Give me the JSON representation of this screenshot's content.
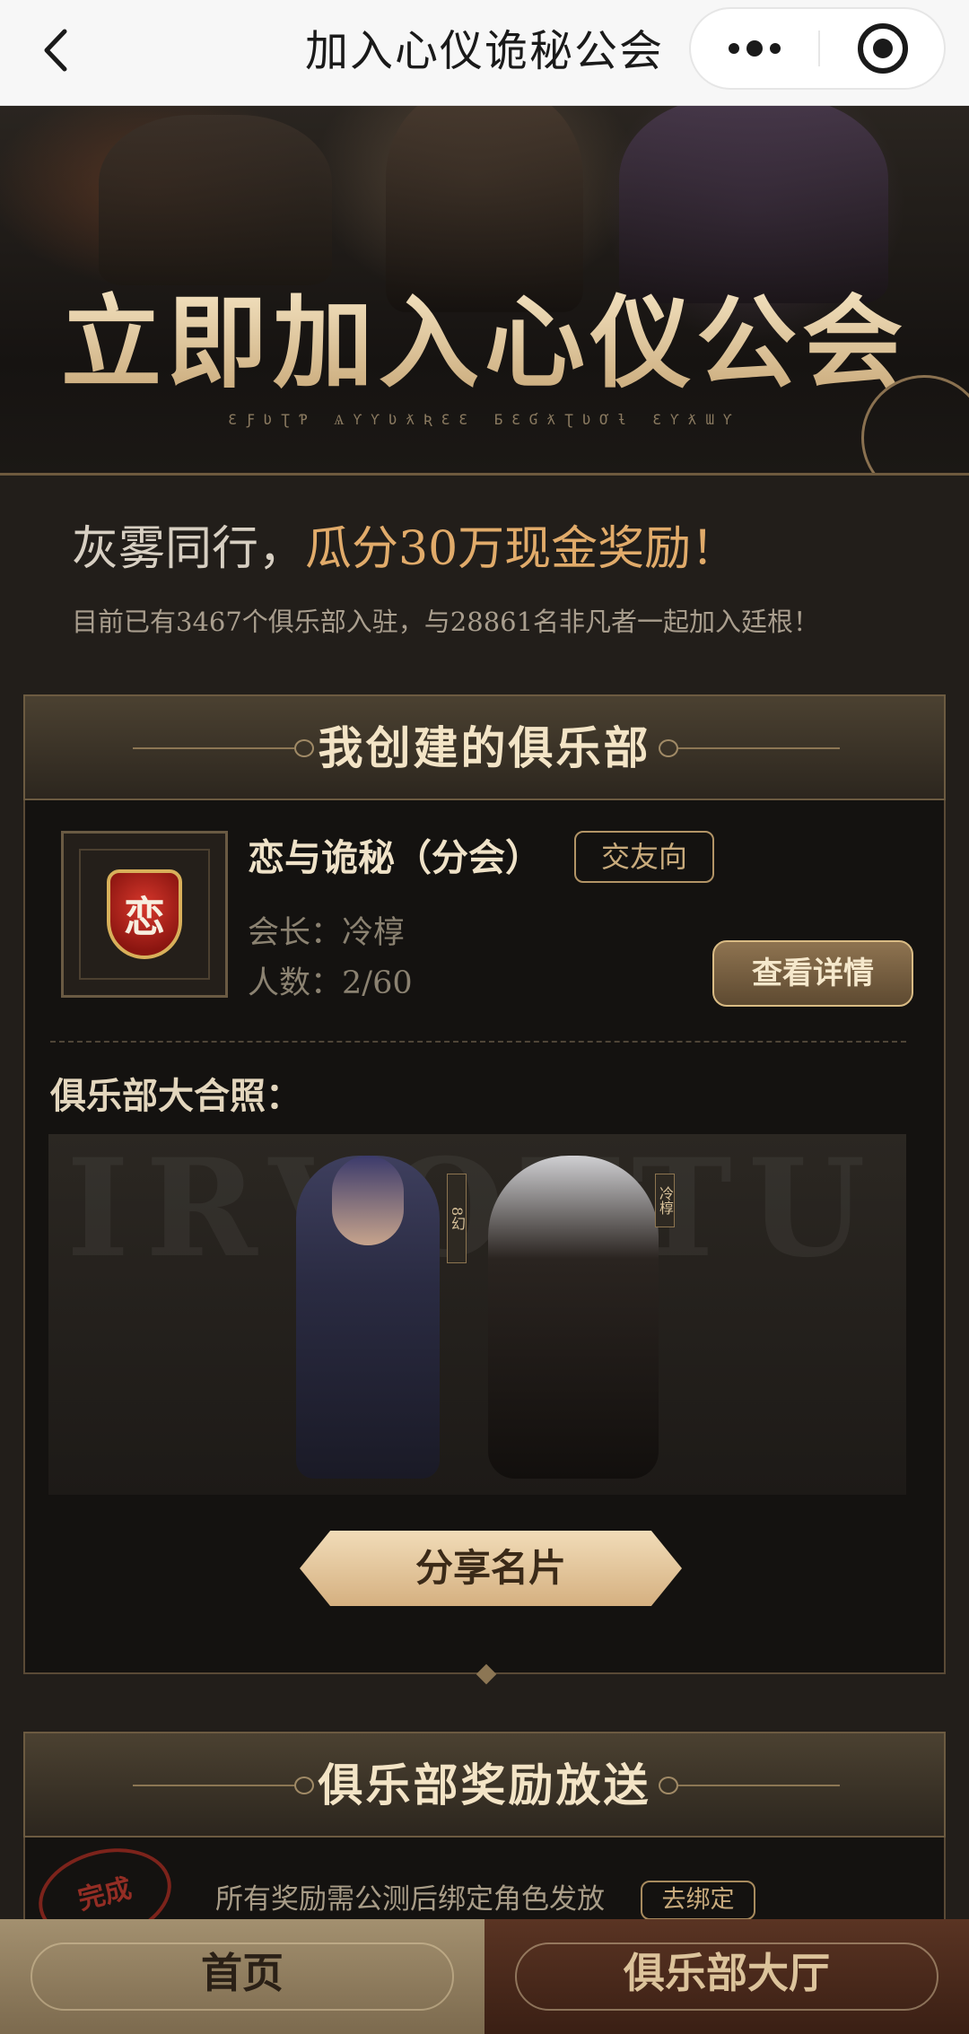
{
  "navbar": {
    "title": "加入心仪诡秘公会",
    "back_icon": "chevron-left-icon",
    "more_icon": "more-dots-icon",
    "close_icon": "target-circle-icon"
  },
  "hero": {
    "title": "立即加入心仪公会",
    "subtitle": "ƐƑƲƮƤ ѦƳƳƲƛƦƐƐ ƂƐƓƛƮƲƠƚ ƐƳƛƜƳ"
  },
  "intro": {
    "headline_plain": "灰雾同行，",
    "headline_accent": "瓜分30万现金奖励！",
    "subline": "目前已有3467个俱乐部入驻，与28861名非凡者一起加入廷根！"
  },
  "my_club": {
    "section_title": "我创建的俱乐部",
    "emblem_char": "恋",
    "name": "恋与诡秘（分会）",
    "tag": "交友向",
    "leader_label": "会长：",
    "leader_value": "冷椁",
    "members_label": "人数：",
    "members_value": "2/60",
    "detail_button": "查看详情",
    "photo_label": "俱乐部大合照：",
    "photo_watermark": "IRVOTTU",
    "name_plate_left": "8幻",
    "name_plate_right": "冷椁",
    "share_button": "分享名片"
  },
  "rewards": {
    "section_title": "俱乐部奖励放送",
    "note": "所有奖励需公测后绑定角色发放",
    "bind_button": "去绑定",
    "stamp_text": "完成"
  },
  "tabbar": {
    "home": "首页",
    "hall": "俱乐部大厅"
  },
  "colors": {
    "accent_gold": "#e1ab6a",
    "background": "#221e1a",
    "card": "#141210"
  }
}
